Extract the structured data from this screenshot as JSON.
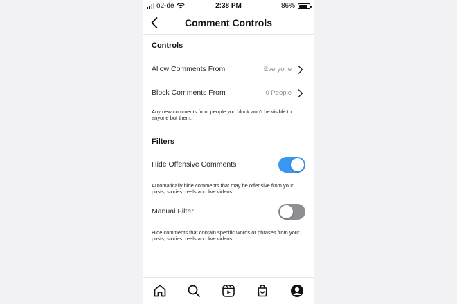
{
  "status_bar": {
    "carrier": "o2-de",
    "time": "2:38 PM",
    "battery": "86%",
    "battery_level": 0.86
  },
  "header": {
    "title": "Comment Controls",
    "back_icon": "chevron-left-icon"
  },
  "controls": {
    "title": "Controls",
    "allow_comments": {
      "label": "Allow Comments From",
      "value": "Everyone"
    },
    "block_comments": {
      "label": "Block Comments From",
      "value": "0 People"
    },
    "note": "Any new comments from people you block won't be visible to anyone but them."
  },
  "filters": {
    "title": "Filters",
    "hide_offensive": {
      "label": "Hide Offensive Comments",
      "enabled": true,
      "note": "Automatically hide comments that may be offensive from your posts, stories, reels and live videos."
    },
    "manual_filter": {
      "label": "Manual Filter",
      "enabled": false,
      "note": "Hide comments that contain specific words or phrases from your posts, stories, reels and live videos."
    }
  },
  "colors": {
    "toggle_on": "#3897f0",
    "toggle_off": "#8e8e93"
  },
  "tab_bar": [
    "home-icon",
    "search-icon",
    "reels-icon",
    "shop-icon",
    "profile-icon"
  ]
}
